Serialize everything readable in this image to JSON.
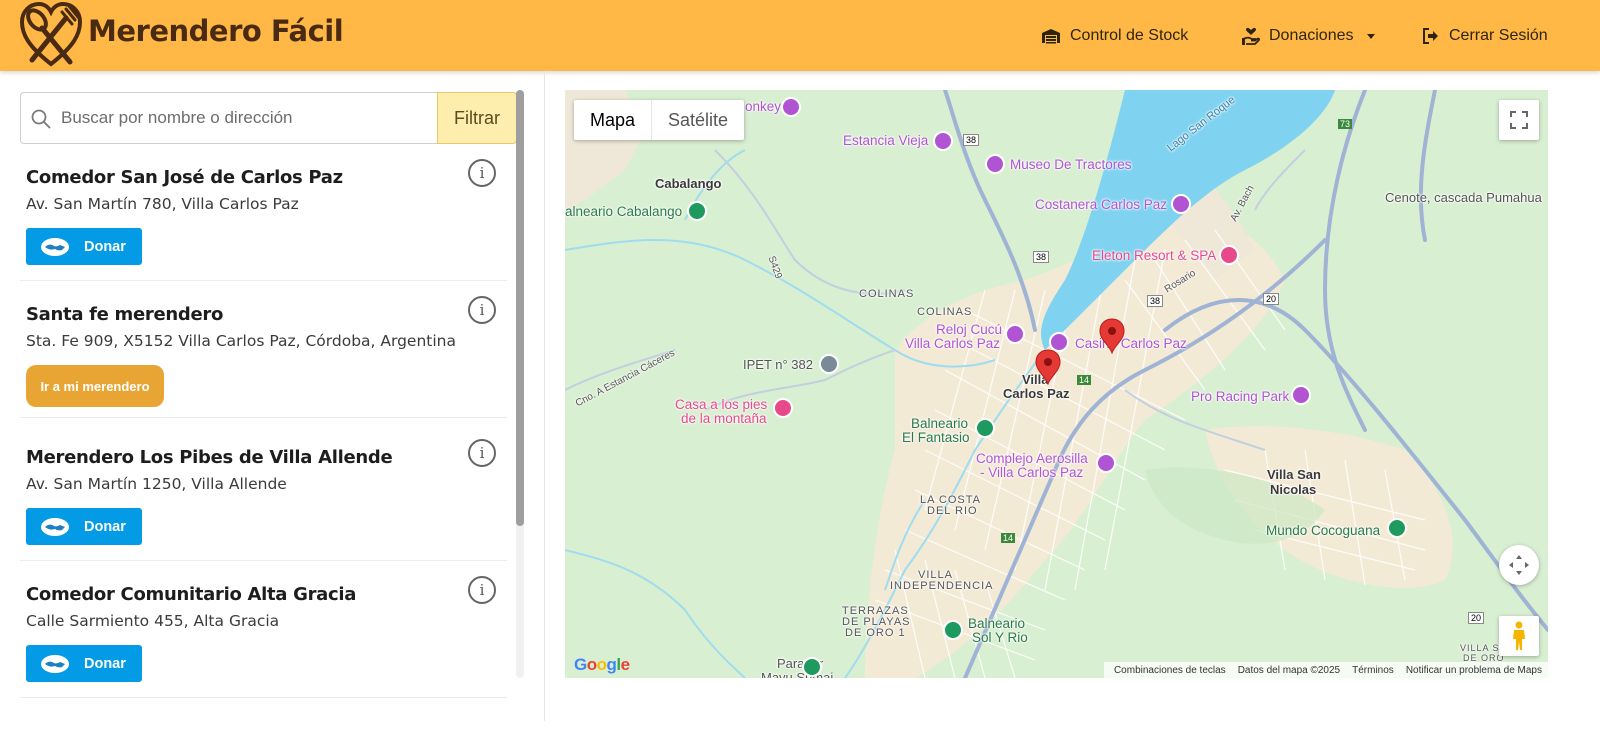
{
  "header": {
    "brand": "Merendero Fácil",
    "nav": {
      "stock": "Control de Stock",
      "donations": "Donaciones",
      "logout": "Cerrar Sesión"
    },
    "colors": {
      "background": "#ffb845",
      "brand_text": "#4a2a12"
    }
  },
  "search": {
    "placeholder": "Buscar por nombre o dirección",
    "value": "",
    "filter_label": "Filtrar"
  },
  "merenderos": [
    {
      "name": "Comedor San José de Carlos Paz",
      "address": "Av. San Martín 780, Villa Carlos Paz",
      "action": "Donar"
    },
    {
      "name": "Santa fe merendero",
      "address": "Sta. Fe 909, X5152 Villa Carlos Paz, Córdoba, Argentina",
      "action": "Ir a mi merendero"
    },
    {
      "name": "Merendero Los Pibes de Villa Allende",
      "address": "Av. San Martín 1250, Villa Allende",
      "action": "Donar"
    },
    {
      "name": "Comedor Comunitario Alta Gracia",
      "address": "Calle Sarmiento 455, Alta Gracia",
      "action": "Donar"
    }
  ],
  "info_glyph": "i",
  "map": {
    "type_controls": {
      "map": "Mapa",
      "satellite": "Satélite",
      "selected": "Mapa"
    },
    "labels": {
      "monkey": "onkey",
      "estancia_vieja": "Estancia Vieja",
      "museo": "Museo De Tractores",
      "cabalango": "Cabalango",
      "balneario_cabalango": "alneario Cabalango",
      "costanera": "Costanera Carlos Paz",
      "lago": "Lago San Roque",
      "cenote": "Cenote, cascada Pumahua",
      "eleton": "Eleton Resort & SPA",
      "colinas_a": "COLINAS",
      "colinas_b": "COLINAS",
      "reloj_1": "Reloj Cucú",
      "reloj_2": "Villa Carlos Paz",
      "casino": "Casino Carlos Paz",
      "ipet": "IPET n° 382",
      "villa_cp_1": "Villa",
      "villa_cp_2": "Carlos Paz",
      "estancia_caceres": "Cno. A Estancia Cáceres",
      "casa_1": "Casa a los pies",
      "casa_2": "de la montaña",
      "balneario_ef_1": "Balneario",
      "balneario_ef_2": "El Fantasio",
      "pro_racing": "Pro Racing Park",
      "aerosilla_1": "Complejo Aerosilla",
      "aerosilla_2": "- Villa Carlos Paz",
      "villa_sn_1": "Villa San",
      "villa_sn_2": "Nicolas",
      "costa_rio_1": "LA COSTA",
      "costa_rio_2": "DEL RIO",
      "mundo": "Mundo Cocoguana",
      "independencia_1": "VILLA",
      "independencia_2": "INDEPENDENCIA",
      "terrazas_1": "TERRAZAS",
      "terrazas_2": "DE PLAYAS",
      "terrazas_3": "DE ORO 1",
      "sol_rio_1": "Balneario",
      "sol_rio_2": "Sol Y Rio",
      "parador_1": "Parador",
      "parador_2": "Mayu Sumaj",
      "villa_sl_1": "VILLA SI",
      "villa_sl_2": "DE ORO",
      "av_bach": "Av. Bach",
      "rosario": "Rosario",
      "s429": "S429"
    },
    "route_shields": [
      "38",
      "38",
      "38",
      "14",
      "14",
      "20",
      "20",
      "73"
    ],
    "attribution": {
      "shortcuts": "Combinaciones de teclas",
      "data": "Datos del mapa ©2025",
      "terms": "Términos",
      "report": "Notificar un problema de Maps"
    },
    "google_logo": "Google"
  }
}
